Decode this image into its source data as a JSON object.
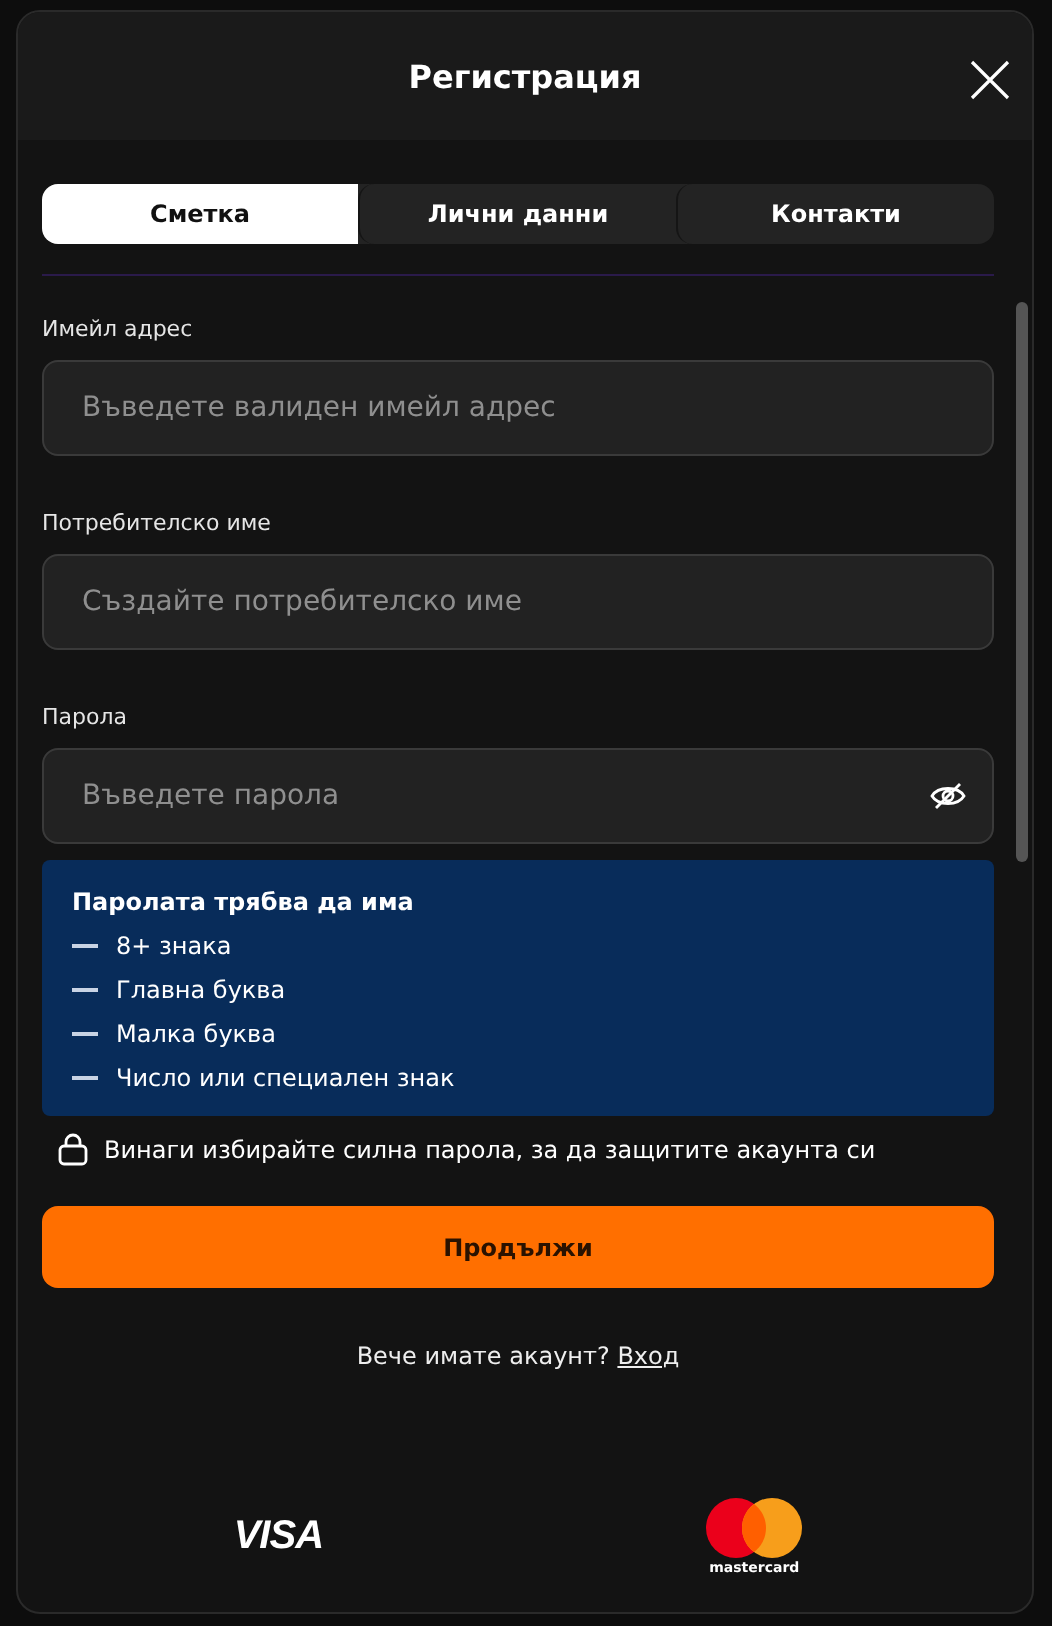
{
  "dialog": {
    "title": "Регистрация"
  },
  "tabs": [
    {
      "label": "Сметка",
      "selected": true
    },
    {
      "label": "Лични данни",
      "selected": false
    },
    {
      "label": "Контакти",
      "selected": false
    }
  ],
  "fields": [
    {
      "label": "Имейл адрес",
      "placeholder": "Въведете валиден имейл адрес",
      "kind": "text"
    },
    {
      "label": "Потребителско име",
      "placeholder": "Създайте потребителско име",
      "kind": "text"
    },
    {
      "label": "Парола",
      "placeholder": "Въведете парола",
      "kind": "password"
    }
  ],
  "password_rules": {
    "title": "Паролата трябва да има",
    "items": [
      "8+ знака",
      "Главна буква",
      "Малка буква",
      "Число или специален знак"
    ]
  },
  "security_tip": "Винаги избирайте силна парола, за да защитите акаунта си",
  "continue_button": "Продължи",
  "login_prompt": {
    "text": "Вече имате акаунт?",
    "link": "Вход"
  },
  "payment_logos": [
    {
      "kind": "visa",
      "text": "VISA"
    },
    {
      "kind": "mastercard",
      "text": "mastercard"
    }
  ]
}
